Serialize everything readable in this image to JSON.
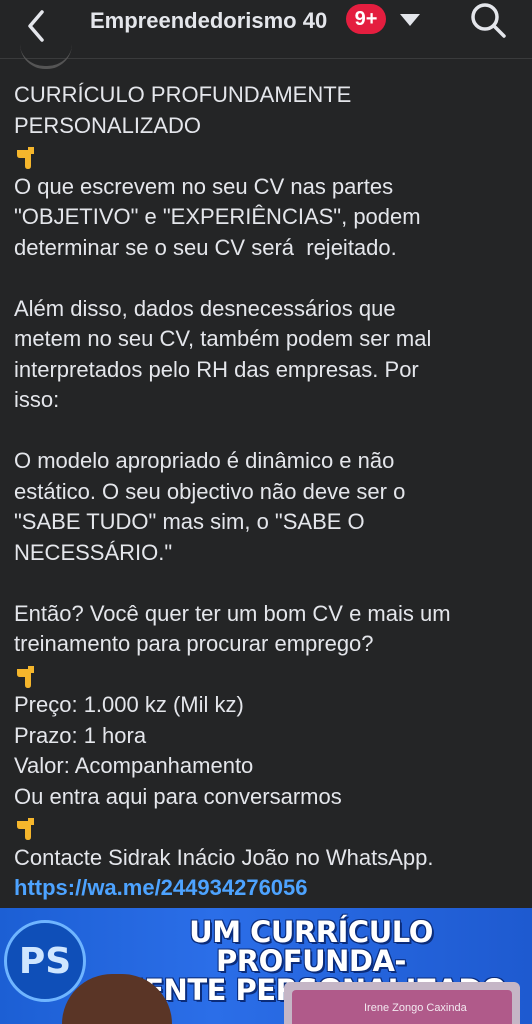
{
  "header": {
    "group_name": "Empreendedorismo 40",
    "notification_badge": "9+"
  },
  "post": {
    "paragraphs": [
      [
        "CURRÍCULO PROFUNDAMENTE",
        "PERSONALIZADO"
      ],
      [
        "O que escrevem no seu CV nas partes",
        "\"OBJETIVO\" e \"EXPERIÊNCIAS\", podem",
        "determinar se o seu CV será  rejeitado."
      ],
      [
        "Além disso, dados desnecessários que",
        "metem no seu CV, também podem ser mal",
        "interpretados pelo RH das empresas. Por",
        "isso:"
      ],
      [
        "O modelo apropriado é dinâmico e não",
        "estático. O seu objectivo não deve ser o",
        "\"SABE TUDO\" mas sim, o \"SABE O",
        "NECESSÁRIO.\""
      ],
      [
        "Então? Você quer ter um bom CV e mais um",
        "treinamento para procurar emprego?"
      ],
      [
        "Preço: 1.000 kz (Mil kz)",
        "Prazo: 1 hora",
        "Valor: Acompanhamento",
        "Ou entra aqui para conversarmos"
      ],
      [
        "Contacte Sidrak Inácio João no WhatsApp."
      ]
    ],
    "link": "https://wa.me/244934276056"
  },
  "banner": {
    "logo_text": "PS",
    "title_line1": "UM CURRÍCULO PROFUNDA-",
    "title_line2": "MENTE PERSONALIZADO",
    "card_name": "Irene Zongo Caxinda"
  },
  "colors": {
    "background": "#242526",
    "text": "#e4e6eb",
    "link": "#4da3ff",
    "badge": "#e41e3f",
    "banner": "#2b6ee8"
  },
  "icons": [
    "back-arrow-icon",
    "dropdown-caret-icon",
    "search-icon",
    "pointing-down-emoji-icon"
  ]
}
